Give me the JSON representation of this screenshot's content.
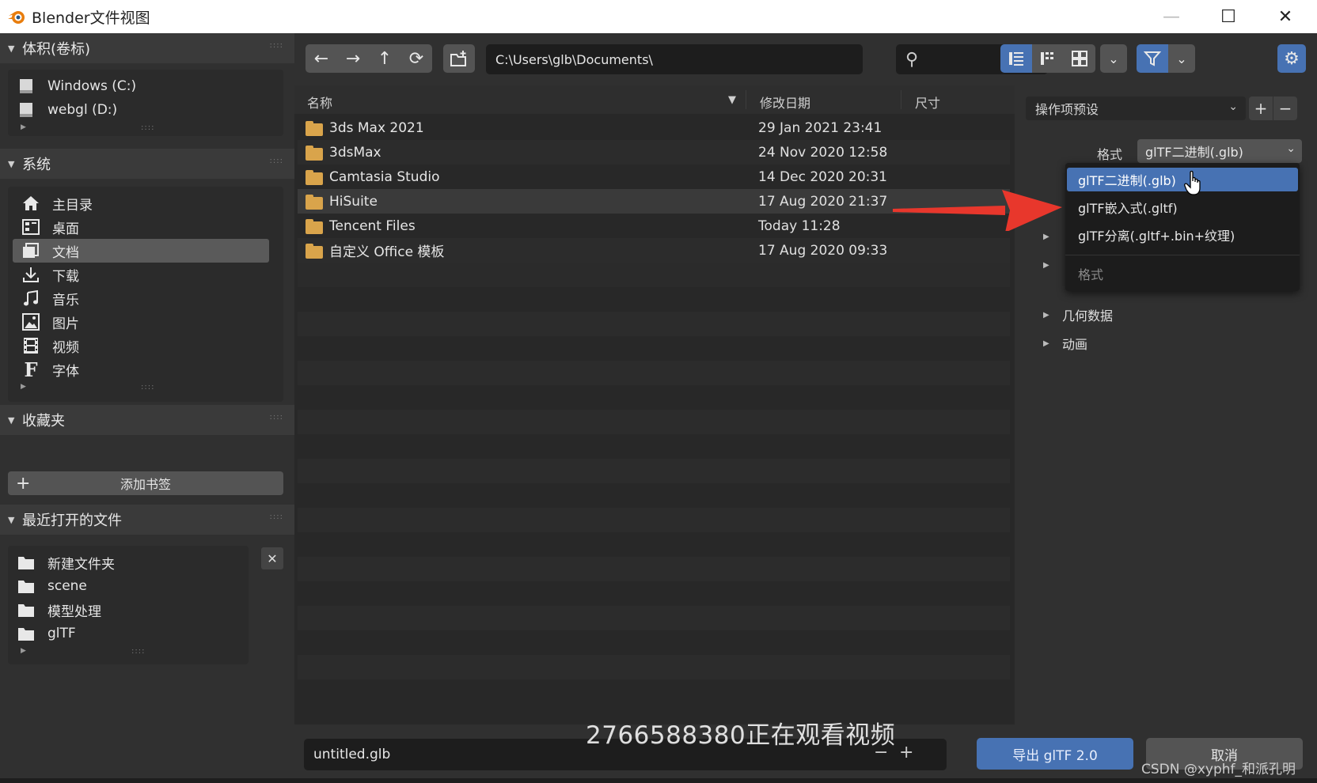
{
  "window": {
    "title": "Blender文件视图",
    "min_glyph": "—",
    "max_glyph": "☐",
    "close_glyph": "✕"
  },
  "sidebar": {
    "volumes": {
      "title": "体积(卷标)",
      "items": [
        {
          "label": "Windows (C:)",
          "icon": "drive-icon"
        },
        {
          "label": "webgl (D:)",
          "icon": "drive-icon"
        }
      ]
    },
    "system": {
      "title": "系统",
      "items": [
        {
          "label": "主目录",
          "icon": "home-icon"
        },
        {
          "label": "桌面",
          "icon": "desktop-icon"
        },
        {
          "label": "文档",
          "icon": "documents-icon",
          "active": true
        },
        {
          "label": "下载",
          "icon": "download-icon"
        },
        {
          "label": "音乐",
          "icon": "music-icon"
        },
        {
          "label": "图片",
          "icon": "image-icon"
        },
        {
          "label": "视频",
          "icon": "video-icon"
        },
        {
          "label": "字体",
          "icon": "font-icon"
        }
      ]
    },
    "bookmarks": {
      "title": "收藏夹",
      "add_label": "添加书签"
    },
    "recent": {
      "title": "最近打开的文件",
      "items": [
        {
          "label": "新建文件夹",
          "icon": "folder-icon"
        },
        {
          "label": "scene",
          "icon": "folder-icon"
        },
        {
          "label": "模型处理",
          "icon": "folder-icon"
        },
        {
          "label": "glTF",
          "icon": "folder-icon"
        }
      ]
    }
  },
  "toolbar": {
    "path": "C:\\Users\\glb\\Documents\\",
    "search_placeholder": ""
  },
  "filelist": {
    "columns": {
      "name": "名称",
      "date": "修改日期",
      "size": "尺寸"
    },
    "rows": [
      {
        "name": "3ds Max 2021",
        "date": "29 Jan 2021 23:41"
      },
      {
        "name": "3dsMax",
        "date": "24 Nov 2020 12:58"
      },
      {
        "name": "Camtasia Studio",
        "date": "14 Dec 2020 20:31"
      },
      {
        "name": "HiSuite",
        "date": "17 Aug 2020 21:37"
      },
      {
        "name": "Tencent Files",
        "date": "Today 11:28"
      },
      {
        "name": "自定义 Office 模板",
        "date": "17 Aug 2020 09:33"
      }
    ]
  },
  "rightpanel": {
    "presets_label": "操作项预设",
    "format_label": "格式",
    "format_value": "glTF二进制(.glb)",
    "sections": [
      "几何数据",
      "动画"
    ],
    "dropdown": {
      "options": [
        "glTF二进制(.glb)",
        "glTF嵌入式(.gltf)",
        "glTF分离(.gltf+.bin+纹理)"
      ],
      "title": "格式"
    }
  },
  "bottombar": {
    "filename": "untitled.glb",
    "export_label": "导出 glTF 2.0",
    "cancel_label": "取消"
  },
  "overlay": {
    "viewer_text": "2766588380正在观看视频",
    "watermark": "CSDN @xyphf_和派孔明"
  },
  "colors": {
    "accent_blue": "#4772b3",
    "folder": "#d9a44b",
    "arrow_red": "#e8372c"
  }
}
